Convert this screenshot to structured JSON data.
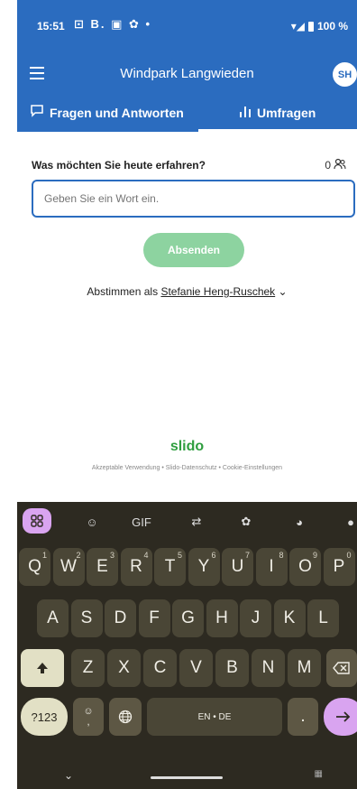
{
  "status_bar": {
    "time": "15:51",
    "icons": "⊡ B. ▣ ✿ •",
    "battery": "100 %"
  },
  "app_bar": {
    "title": "Windpark Langwieden",
    "avatar": "SH"
  },
  "tabs": [
    {
      "label": "Fragen und Antworten",
      "icon": "speech-bubble-icon",
      "active": false
    },
    {
      "label": "Umfragen",
      "icon": "poll-bars-icon",
      "active": true
    }
  ],
  "poll": {
    "question": "Was möchten Sie heute erfahren?",
    "participants": "0",
    "input_placeholder": "Geben Sie ein Wort ein.",
    "submit_label": "Absenden",
    "vote_as_prefix": "Abstimmen als",
    "user_name": "Stefanie Heng-Ruschek"
  },
  "footer": {
    "brand": "slido",
    "links": "Akzeptable Verwendung • Slido-Datenschutz • Cookie-Einstellungen"
  },
  "keyboard": {
    "toolbar": [
      "apps-grid-icon",
      "sticker-icon",
      "GIF",
      "translate-icon",
      "gear-icon",
      "palette-icon",
      "mic-icon"
    ],
    "gif_label": "GIF",
    "row1": [
      {
        "k": "Q",
        "n": "1"
      },
      {
        "k": "W",
        "n": "2"
      },
      {
        "k": "E",
        "n": "3"
      },
      {
        "k": "R",
        "n": "4"
      },
      {
        "k": "T",
        "n": "5"
      },
      {
        "k": "Y",
        "n": "6"
      },
      {
        "k": "U",
        "n": "7"
      },
      {
        "k": "I",
        "n": "8"
      },
      {
        "k": "O",
        "n": "9"
      },
      {
        "k": "P",
        "n": "0"
      }
    ],
    "row2": [
      "A",
      "S",
      "D",
      "F",
      "G",
      "H",
      "J",
      "K",
      "L"
    ],
    "row3": [
      "Z",
      "X",
      "C",
      "V",
      "B",
      "N",
      "M"
    ],
    "num_label": "?123",
    "space_label": "EN • DE",
    "period_label": ".",
    "comma_label": ","
  },
  "colors": {
    "brand_blue": "#2b6cbf",
    "submit_green": "#8dd3a0",
    "slido_green": "#2f9e3f",
    "keyboard_bg": "#2d2a21"
  }
}
